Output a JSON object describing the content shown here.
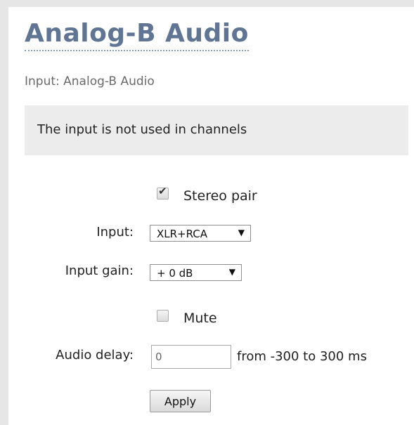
{
  "title": "Analog-B Audio",
  "subtitle": "Input: Analog-B Audio",
  "notice": "The input is not used in channels",
  "stereo": {
    "label": "Stereo pair",
    "checked": true
  },
  "input": {
    "label": "Input:",
    "selected": "XLR+RCA"
  },
  "gain": {
    "label": "Input gain:",
    "selected": "+ 0 dB"
  },
  "mute": {
    "label": "Mute",
    "checked": false
  },
  "delay": {
    "label": "Audio delay:",
    "value": "0",
    "range": "from -300 to 300 ms"
  },
  "apply_label": "Apply",
  "icons": {
    "dropdown": "triangle-down",
    "check": "checkmark"
  }
}
